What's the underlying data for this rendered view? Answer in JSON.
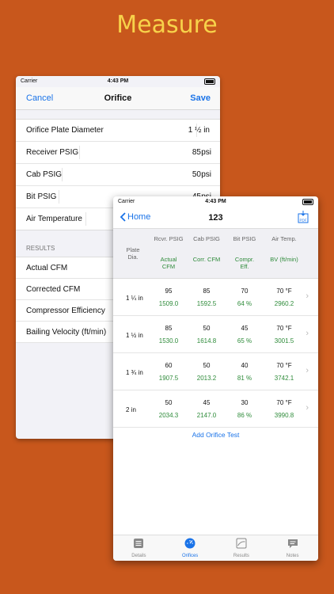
{
  "headline": "Measure",
  "status_bar": {
    "carrier": "Carrier",
    "time": "4:43 PM"
  },
  "orifice_screen": {
    "cancel_label": "Cancel",
    "title": "Orifice",
    "save_label": "Save",
    "fields": [
      {
        "label": "Orifice Plate Diameter",
        "value": "1 ½ in",
        "unit": ""
      },
      {
        "label": "Receiver PSIG",
        "value": "85",
        "unit": "psi"
      },
      {
        "label": "Cab PSIG",
        "value": "50",
        "unit": "psi"
      },
      {
        "label": "Bit PSIG",
        "value": "45",
        "unit": "psi"
      },
      {
        "label": "Air Temperature",
        "value": "",
        "unit": ""
      }
    ],
    "results_header": "RESULTS",
    "results": [
      {
        "label": "Actual CFM"
      },
      {
        "label": "Corrected CFM"
      },
      {
        "label": "Compressor Efficiency"
      },
      {
        "label": "Bailing Velocity (ft/min)"
      }
    ]
  },
  "table_screen": {
    "back_label": "Home",
    "title": "123",
    "pdf_label": "PDF",
    "header_top": [
      "Rcvr. PSIG",
      "Cab PSIG",
      "Bit PSIG",
      "Air Temp."
    ],
    "header_plate": "Plate\nDia.",
    "header_bottom": [
      "Actual CFM",
      "Corr. CFM",
      "Compr. Eff.",
      "BV (ft/min)"
    ],
    "rows": [
      {
        "plate": "1 ¼ in",
        "top": [
          "95",
          "85",
          "70",
          "70 °F"
        ],
        "bottom": [
          "1509.0",
          "1592.5",
          "64 %",
          "2960.2"
        ]
      },
      {
        "plate": "1 ½ in",
        "top": [
          "85",
          "50",
          "45",
          "70 °F"
        ],
        "bottom": [
          "1530.0",
          "1614.8",
          "65 %",
          "3001.5"
        ]
      },
      {
        "plate": "1 ¾ in",
        "top": [
          "60",
          "50",
          "40",
          "70 °F"
        ],
        "bottom": [
          "1907.5",
          "2013.2",
          "81 %",
          "3742.1"
        ]
      },
      {
        "plate": "2  in",
        "top": [
          "50",
          "45",
          "30",
          "70 °F"
        ],
        "bottom": [
          "2034.3",
          "2147.0",
          "86 %",
          "3990.8"
        ]
      }
    ],
    "add_test_label": "Add Orifice Test",
    "tabs": [
      {
        "label": "Details",
        "icon": "list-icon"
      },
      {
        "label": "Orifices",
        "icon": "gauge-icon"
      },
      {
        "label": "Results",
        "icon": "chart-icon"
      },
      {
        "label": "Notes",
        "icon": "notes-icon"
      }
    ]
  },
  "colors": {
    "background": "#c8571c",
    "headline": "#f7d24a",
    "accent": "#1a73e8",
    "green": "#2e8b3a"
  }
}
